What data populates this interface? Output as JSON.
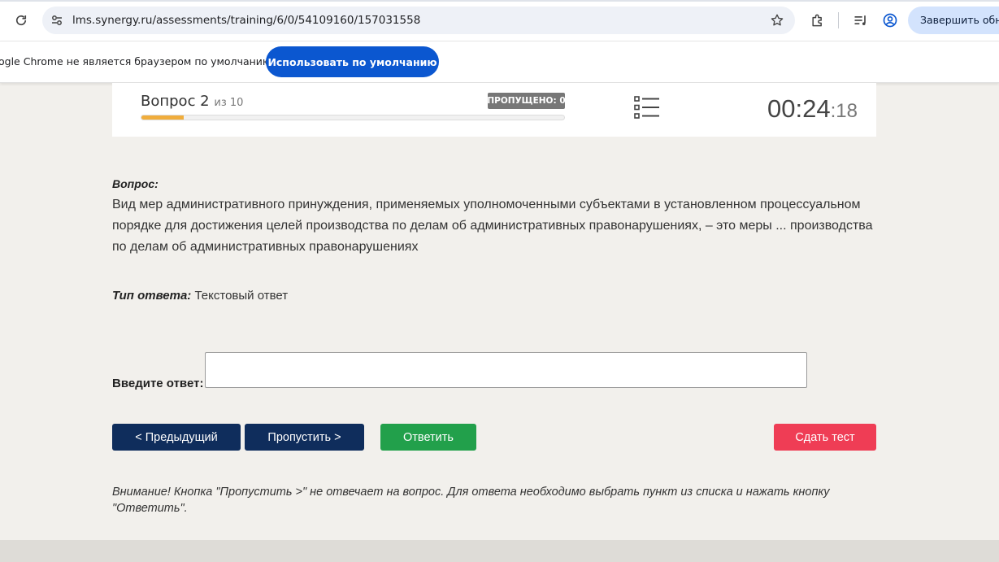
{
  "browser": {
    "url": "lms.synergy.ru/assessments/training/6/0/54109160/157031558",
    "update_button": "Завершить обновление"
  },
  "infobar": {
    "message": "ogle Chrome не является браузером по умолчанию.",
    "default_button": "Использовать по умолчанию"
  },
  "test_header": {
    "question_label": "Вопрос 2",
    "question_of": "из 10",
    "skipped": "ПРОПУЩЕНО: 0",
    "progress": 0.1,
    "timer_main": "00:24",
    "timer_sec": ":18"
  },
  "question": {
    "label": "Вопрос:",
    "text": "Вид мер административного принуждения, применяемых уполномоченными субъектами в установленном процессуальном порядке для достижения целей производства по делам об административных правонарушениях, – это меры ... производства по делам об административных правонарушениях"
  },
  "answer": {
    "type_label": "Тип ответа:",
    "type_value": "Текстовый ответ",
    "input_label": "Введите ответ:",
    "input_value": ""
  },
  "buttons": {
    "prev": "< Предыдущий",
    "skip": "Пропустить >",
    "answer": "Ответить",
    "submit": "Сдать тест"
  },
  "notice": "Внимание! Кнопка \"Пропустить >\" не отвечает на вопрос. Для ответа необходимо выбрать пункт из списка и нажать кнопку \"Ответить\".",
  "colors": {
    "accent_blue": "#0b57d0",
    "nav_button": "#0f2d5c",
    "answer_button": "#22a04b",
    "submit_button": "#ef3d55",
    "progress_fill": "#f0ad3c"
  }
}
